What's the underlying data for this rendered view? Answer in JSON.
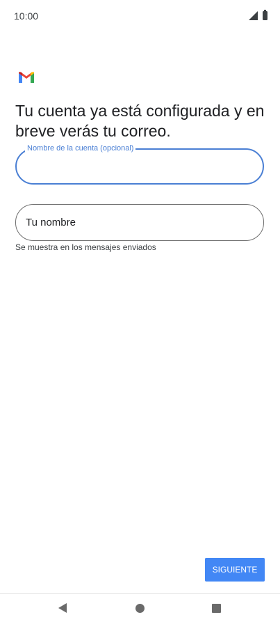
{
  "status_bar": {
    "time": "10:00",
    "icons": [
      "signal-icon",
      "battery-icon"
    ]
  },
  "logo": "gmail-logo",
  "heading": "Tu cuenta ya está configurada y en breve verás tu correo.",
  "account_name_field": {
    "label": "Nombre de la cuenta (opcional)",
    "value": ""
  },
  "your_name_field": {
    "placeholder": "Tu nombre",
    "value": "",
    "helper": "Se muestra en los mensajes enviados"
  },
  "next_button": {
    "label": "SIGUIENTE"
  },
  "nav_bar": {
    "items": [
      "back-icon",
      "home-icon",
      "recents-icon"
    ]
  },
  "colors": {
    "accent": "#4287f5",
    "focused_outline": "#4a7fd4",
    "text": "#202124"
  }
}
